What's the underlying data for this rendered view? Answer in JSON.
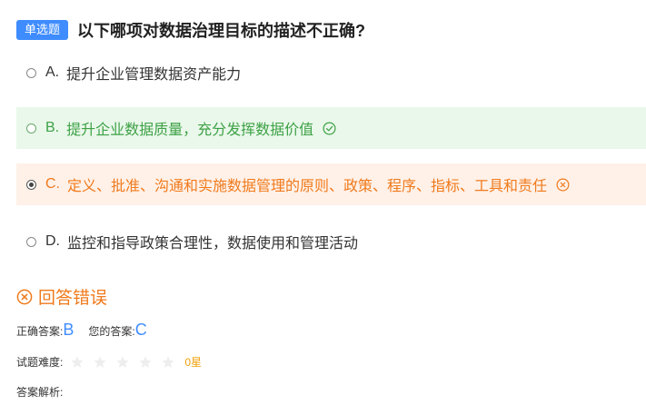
{
  "question": {
    "type_label": "单选题",
    "title": "以下哪项对数据治理目标的描述不正确?"
  },
  "options": [
    {
      "letter": "A.",
      "text": "提升企业管理数据资产能力",
      "state": "none"
    },
    {
      "letter": "B.",
      "text": "提升企业数据质量，充分发挥数据价值",
      "state": "correct"
    },
    {
      "letter": "C.",
      "text": "定义、批准、沟通和实施数据管理的原则、政策、程序、指标、工具和责任",
      "state": "wrong-selected"
    },
    {
      "letter": "D.",
      "text": "监控和指导政策合理性，数据使用和管理活动",
      "state": "none"
    }
  ],
  "result": {
    "text": "回答错误",
    "icon": "x-circle-icon"
  },
  "answers": {
    "correct_label": "正确答案:",
    "correct_value": "B",
    "yours_label": "您的答案:",
    "yours_value": "C"
  },
  "difficulty": {
    "label": "试题难度:",
    "stars_filled": 0,
    "stars_total": 5,
    "value_text": "0星"
  },
  "analysis": {
    "label": "答案解析:"
  },
  "colors": {
    "accent_blue": "#3f8cff",
    "correct_green": "#3ea146",
    "correct_bg": "#e9f8ea",
    "wrong_orange": "#f07a1c",
    "wrong_bg": "#fff1e8",
    "star_gold": "#f2a20c"
  }
}
